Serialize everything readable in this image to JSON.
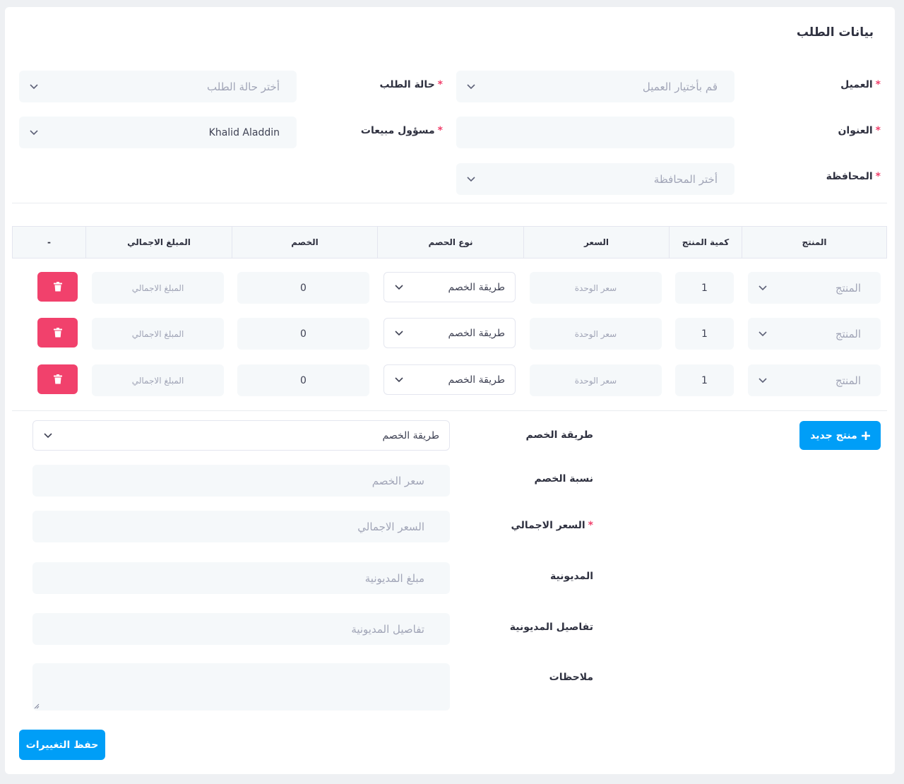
{
  "page": {
    "title": "بيانات الطلب"
  },
  "order": {
    "customer_label": "العميل",
    "customer_placeholder": "قم بأختيار العميل",
    "status_label": "حالة الطلب",
    "status_placeholder": "أختر حالة الطلب",
    "address_label": "العنوان",
    "address_value": "",
    "sales_label": "مسؤول مبيعات",
    "sales_value": "Khalid Aladdin",
    "governorate_label": "المحافظة",
    "governorate_placeholder": "أختر المحافظة",
    "required_mark": "*"
  },
  "table": {
    "headers": {
      "product": "المنتج",
      "quantity": "كمية المنتج",
      "price": "السعر",
      "discount_type": "نوع الحصم",
      "discount": "الخصم",
      "total": "المبلغ الاجمالي",
      "actions": "-"
    },
    "rows": [
      {
        "product": "المنتج",
        "quantity": "1",
        "price": "سعر الوحدة",
        "discount_type": "طريقة الخصم",
        "discount": "0",
        "total": "المبلغ الاجمالي"
      },
      {
        "product": "المنتج",
        "quantity": "1",
        "price": "سعر الوحدة",
        "discount_type": "طريقة الخصم",
        "discount": "0",
        "total": "المبلغ الاجمالي"
      },
      {
        "product": "المنتج",
        "quantity": "1",
        "price": "سعر الوحدة",
        "discount_type": "طريقة الخصم",
        "discount": "0",
        "total": "المبلغ الاجمالي"
      }
    ]
  },
  "summary": {
    "add_product_button": "منتج جديد",
    "discount_method_label": "طريقة الخصم",
    "discount_method_value": "طريقة الخصم",
    "discount_rate_label": "نسبة الخصم",
    "discount_rate_placeholder": "سعر الخصم",
    "total_price_label": "السعر الاجمالي",
    "total_price_placeholder": "السعر الاجمالي",
    "debt_label": "المديونية",
    "debt_placeholder": "مبلغ المديونية",
    "debt_details_label": "تفاصيل المديونية",
    "debt_details_placeholder": "تفاصيل المديونية",
    "notes_label": "ملاحظات",
    "notes_value": ""
  },
  "actions": {
    "save_button": "حفظ التغييرات"
  },
  "colors": {
    "primary": "#009ef7",
    "danger": "#f1416c",
    "field_bg": "#f5f8fa"
  },
  "icons": {
    "chevron": "chevron-down-icon",
    "delete": "trash-icon",
    "add": "plus-icon",
    "resize": "resize-handle-icon"
  }
}
